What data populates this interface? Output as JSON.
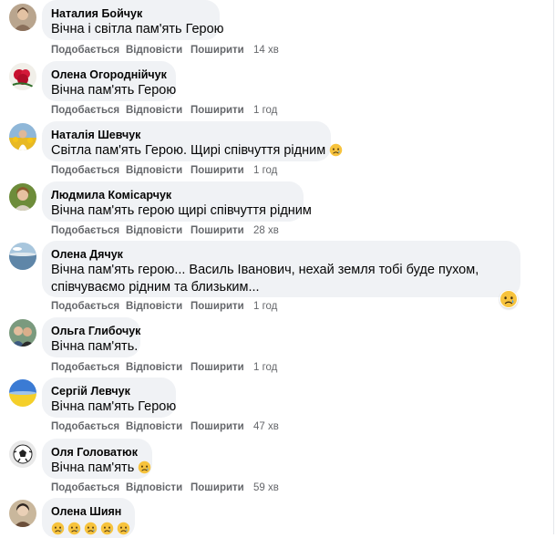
{
  "comments": [
    {
      "author": "Наталия Бойчук",
      "text": "Вічна і світла пам'ять Герою",
      "like": "Подобається",
      "reply": "Відповісти",
      "share": "Поширити",
      "time": "14 хв",
      "avatar": "avatar-photo"
    },
    {
      "author": "Олена Огороднійчук",
      "text": "Вічна пам'ять Герою",
      "like": "Подобається",
      "reply": "Відповісти",
      "share": "Поширити",
      "time": "1 год",
      "avatar": "avatar-photo"
    },
    {
      "author": "Наталія Шевчук",
      "text": "Світла пам'ять Герою. Щирі співчуття рідним",
      "like": "Подобається",
      "reply": "Відповісти",
      "share": "Поширити",
      "time": "1 год",
      "avatar": "avatar-photo",
      "emoji": "crying-face-icon"
    },
    {
      "author": "Людмила Комісарчук",
      "text": "Вічна пам'ять герою щирі співчуття рідним",
      "like": "Подобається",
      "reply": "Відповісти",
      "share": "Поширити",
      "time": "28 хв",
      "avatar": "avatar-photo"
    },
    {
      "author": "Олена Дячук",
      "text_line1": "Вічна пам'ять герою... Василь Іванович, нехай земля тобі буде пухом,",
      "text_line2": "співчуваємо рідним та близьким...",
      "like": "Подобається",
      "reply": "Відповісти",
      "share": "Поширити",
      "time": "1 год",
      "avatar": "avatar-photo",
      "reaction": "sad-reaction-icon"
    },
    {
      "author": "Ольга Глибочук",
      "text": "Вічна пам'ять.",
      "like": "Подобається",
      "reply": "Відповісти",
      "share": "Поширити",
      "time": "1 год",
      "avatar": "avatar-photo"
    },
    {
      "author": "Сергій Левчук",
      "text": "Вічна пам'ять Герою",
      "like": "Подобається",
      "reply": "Відповісти",
      "share": "Поширити",
      "time": "47 хв",
      "avatar": "avatar-photo"
    },
    {
      "author": "Оля Головатюк",
      "text": "Вічна пам'ять",
      "like": "Подобається",
      "reply": "Відповісти",
      "share": "Поширити",
      "time": "59 хв",
      "avatar": "avatar-photo",
      "emoji": "crying-face-icon"
    },
    {
      "author": "Олена Шиян",
      "avatar": "avatar-photo",
      "emoji": "crying-face-icon"
    }
  ],
  "colors": {
    "bubble": "#f0f2f5",
    "meta": "#65676b",
    "text": "#050505"
  }
}
